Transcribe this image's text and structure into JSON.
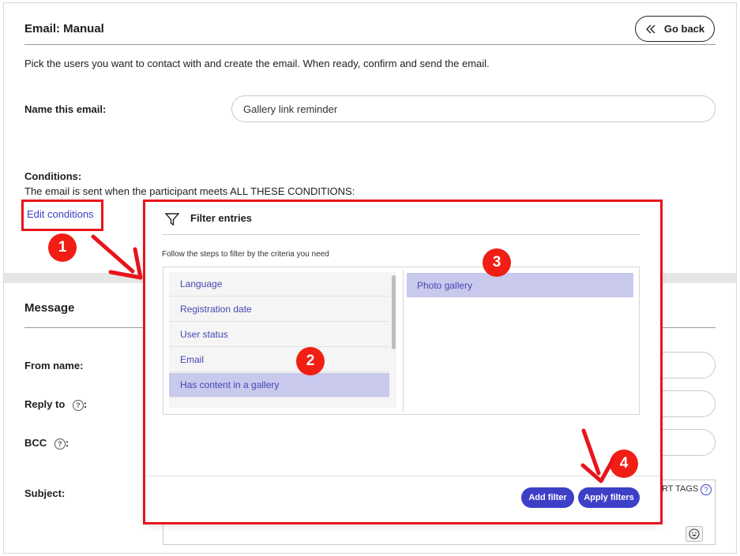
{
  "header": {
    "title": "Email: Manual",
    "go_back_label": "Go back"
  },
  "description": "Pick the users you want to contact with and create the email. When ready, confirm and send the email.",
  "name_email": {
    "label": "Name this email:",
    "value": "Gallery link reminder"
  },
  "conditions": {
    "label": "Conditions:",
    "text": "The email is sent when the participant meets ALL THESE CONDITIONS:",
    "edit_link": "Edit conditions"
  },
  "message": {
    "title": "Message",
    "from_name_label": "From name:",
    "reply_to_label": "Reply to",
    "bcc_label": "BCC",
    "subject_label": "Subject:",
    "insert_tags_label": "RT TAGS",
    "help_glyph": "?",
    "colon": ":"
  },
  "filter_modal": {
    "title": "Filter entries",
    "instructions": "Follow the steps to filter by the criteria you need",
    "criteria": [
      "Language",
      "Registration date",
      "User status",
      "Email",
      "Has content in a gallery"
    ],
    "selected_criterion": "Has content in a gallery",
    "values": [
      "Photo gallery"
    ],
    "add_filter_label": "Add filter",
    "apply_filters_label": "Apply filters"
  },
  "annotations": {
    "badge_1": "1",
    "badge_2": "2",
    "badge_3": "3",
    "badge_4": "4",
    "color": "#e8141b"
  }
}
